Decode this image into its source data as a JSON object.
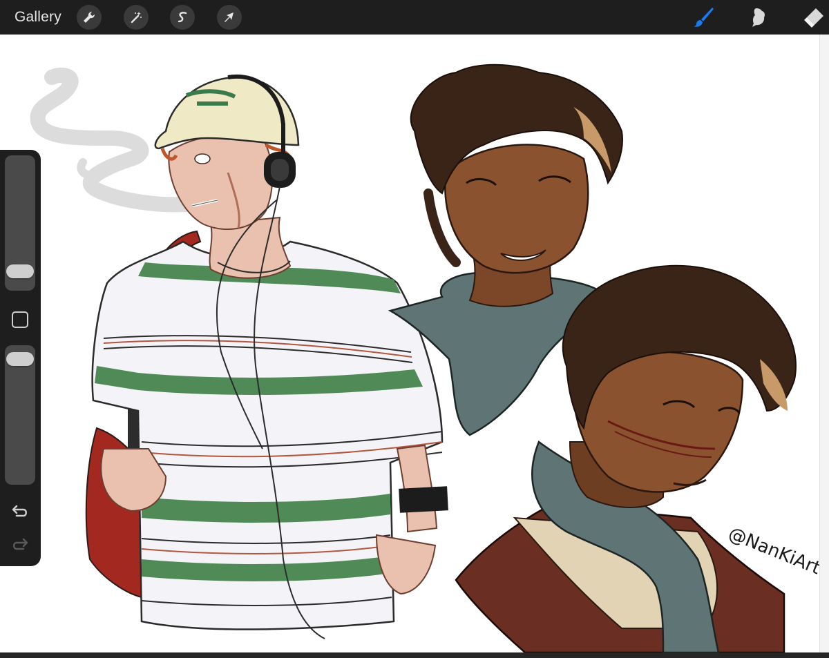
{
  "toolbar": {
    "gallery_label": "Gallery",
    "left_tools": [
      "wrench-icon",
      "magic-wand-icon",
      "selection-icon",
      "transform-arrow-icon"
    ],
    "right_tools": [
      "brush-icon",
      "smudge-icon",
      "eraser-icon"
    ],
    "active_tool": "brush-icon",
    "active_color": "#1a7cf0"
  },
  "sidebar": {
    "brush_size_level": 0.82,
    "opacity_level": 0.95
  },
  "canvas": {
    "signature": "@NanKiArt",
    "palette": {
      "skin_light": "#e9c1ae",
      "skin_dark": "#8b5230",
      "hair_dark": "#3a2418",
      "scarf": "#5f7474",
      "shirt": "#f3f3f8",
      "stripe_green": "#4f8a57",
      "bag_red": "#a3281f",
      "cap": "#efe9c6"
    }
  }
}
